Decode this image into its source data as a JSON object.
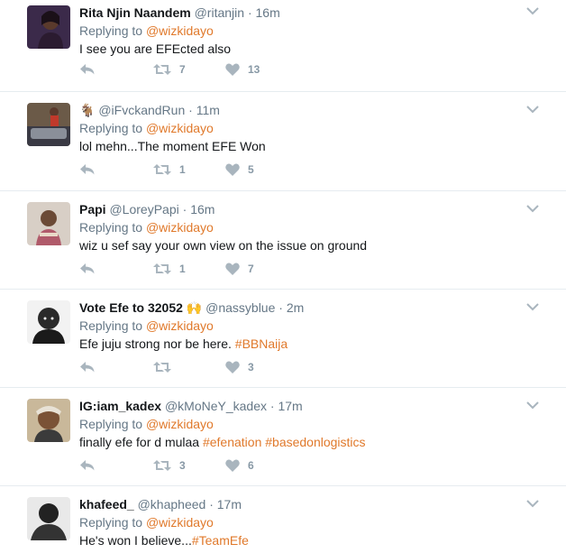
{
  "replying_prefix": "Replying to",
  "tweets": [
    {
      "name": "Rita Njin Naandem",
      "handle": "@ritanjin",
      "separator": "·",
      "time": "16m",
      "mention": "@wizkidayo",
      "text": "I see you are EFEcted also",
      "hashtags": "",
      "retweets": "7",
      "likes": "13"
    },
    {
      "name": "",
      "prefix_emoji": "🐐",
      "handle": "@iFvckandRun",
      "separator": "·",
      "time": "11m",
      "mention": "@wizkidayo",
      "text": "lol mehn...The moment EFE Won",
      "hashtags": "",
      "retweets": "1",
      "likes": "5"
    },
    {
      "name": "Papi",
      "handle": "@LoreyPapi",
      "separator": "·",
      "time": "16m",
      "mention": "@wizkidayo",
      "text": "wiz u sef say your own view on the issue on ground",
      "hashtags": "",
      "retweets": "1",
      "likes": "7"
    },
    {
      "name": "Vote Efe to 32052",
      "suffix_emoji": "🙌",
      "handle": "@nassyblue",
      "separator": "·",
      "time": "2m",
      "mention": "@wizkidayo",
      "text": "Efe juju strong nor be here. ",
      "hashtags": "#BBNaija",
      "retweets": "",
      "likes": "3"
    },
    {
      "name": "IG:iam_kadex",
      "handle": "@kMoNeY_kadex",
      "separator": "·",
      "time": "17m",
      "mention": "@wizkidayo",
      "text": "finally efe for d mulaa ",
      "hashtags": "#efenation #basedonlogistics",
      "retweets": "3",
      "likes": "6"
    },
    {
      "name": "khafeed_",
      "handle": "@khapheed",
      "separator": "·",
      "time": "17m",
      "mention": "@wizkidayo",
      "text": "He's won I believe...",
      "hashtags": "#TeamEfe",
      "retweets": "",
      "likes": ""
    }
  ],
  "icons": {
    "reply": "reply-icon",
    "retweet": "retweet-icon",
    "like": "heart-icon",
    "more": "chevron-down-icon"
  },
  "colors": {
    "link": "#e0792b",
    "secondary_text": "#657786",
    "action_icon": "#a9b5be",
    "divider": "#e6ecf0"
  }
}
